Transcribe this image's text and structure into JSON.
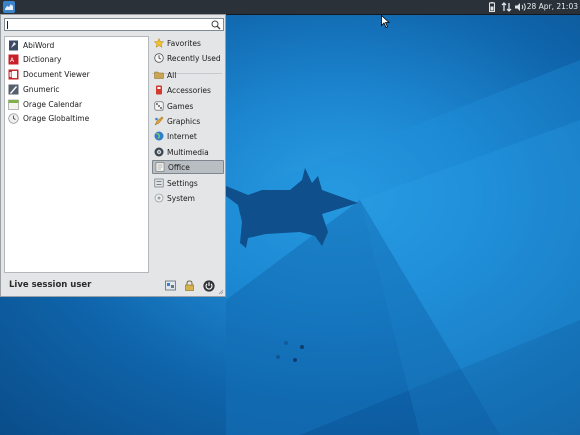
{
  "panel": {
    "clock": "28 Apr, 21:03",
    "tray_icons": [
      "battery-icon",
      "network-icon",
      "volume-icon"
    ]
  },
  "menu": {
    "search": {
      "value": "",
      "placeholder": ""
    },
    "apps": [
      {
        "label": "AbiWord",
        "icon": "abiword-icon"
      },
      {
        "label": "Dictionary",
        "icon": "dictionary-icon"
      },
      {
        "label": "Document Viewer",
        "icon": "document-viewer-icon"
      },
      {
        "label": "Gnumeric",
        "icon": "gnumeric-icon"
      },
      {
        "label": "Orage Calendar",
        "icon": "calendar-icon"
      },
      {
        "label": "Orage Globaltime",
        "icon": "globaltime-icon"
      }
    ],
    "categories": [
      {
        "label": "Favorites",
        "icon": "star-icon"
      },
      {
        "label": "Recently Used",
        "icon": "clock-icon"
      },
      {
        "label": "All",
        "icon": "folder-icon"
      },
      {
        "label": "Accessories",
        "icon": "accessories-icon"
      },
      {
        "label": "Games",
        "icon": "games-icon"
      },
      {
        "label": "Graphics",
        "icon": "graphics-icon"
      },
      {
        "label": "Internet",
        "icon": "globe-icon"
      },
      {
        "label": "Multimedia",
        "icon": "multimedia-icon"
      },
      {
        "label": "Office",
        "icon": "office-icon",
        "selected": true
      },
      {
        "label": "Settings",
        "icon": "settings-icon"
      },
      {
        "label": "System",
        "icon": "system-icon"
      }
    ],
    "user": "Live session user",
    "actions": [
      "settings-manager-icon",
      "lock-screen-icon",
      "power-icon"
    ]
  },
  "colors": {
    "panel_bg": "#2b3138",
    "menu_bg": "#e3e5e6",
    "selection": "#b9bec3",
    "wallpaper_accent": "#1c86d0"
  }
}
